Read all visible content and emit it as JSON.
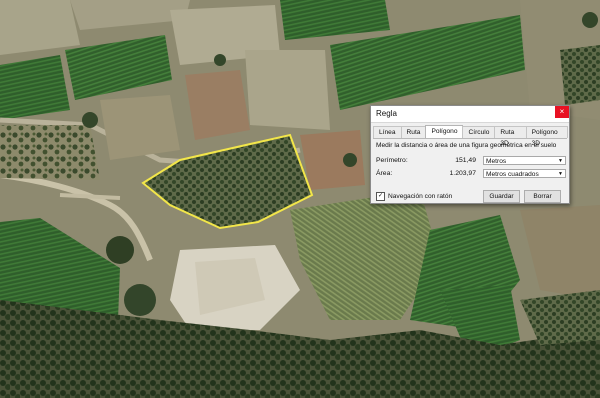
{
  "dialog": {
    "title": "Regla",
    "close_glyph": "×",
    "tabs": [
      "Línea",
      "Ruta",
      "Polígono",
      "Círculo",
      "Ruta 3D",
      "Polígono 3D"
    ],
    "active_tab": "Polígono",
    "description": "Medir la distancia o área de una figura geométrica en el suelo",
    "perimeter": {
      "label": "Perímetro:",
      "value": "151,49",
      "unit": "Metros"
    },
    "area": {
      "label": "Área:",
      "value": "1.203,97",
      "unit": "Metros cuadrados"
    },
    "mouse_nav": {
      "label": "Navegación con ratón",
      "checked": true
    },
    "save_label": "Guardar",
    "clear_label": "Borrar"
  },
  "map": {
    "type": "satellite-imagery",
    "polygon_color": "#f2e64a"
  }
}
